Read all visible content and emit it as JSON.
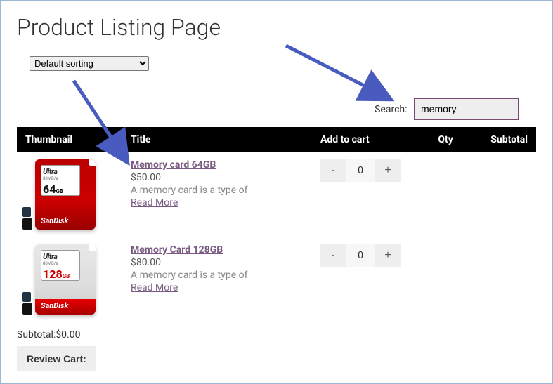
{
  "page": {
    "title": "Product Listing Page"
  },
  "sort": {
    "selected": "Default sorting"
  },
  "search": {
    "label": "Search:",
    "value": "memory"
  },
  "table": {
    "headers": {
      "thumbnail": "Thumbnail",
      "title": "Title",
      "addtocart": "Add to cart",
      "qty": "Qty",
      "subtotal": "Subtotal"
    }
  },
  "products": [
    {
      "title": "Memory card 64GB",
      "price": "$50.00",
      "desc": "A memory card is a type of",
      "readmore": "Read More",
      "qty": "0",
      "thumb": {
        "style": "red",
        "ultra": "Ultra",
        "capacity": "64",
        "brand": "SanDisk",
        "speed": "30MB/s",
        "gb": "GB"
      }
    },
    {
      "title": "Memory Card 128GB",
      "price": "$80.00",
      "desc": "A memory card is a type of",
      "readmore": "Read More",
      "qty": "0",
      "thumb": {
        "style": "silver",
        "ultra": "Ultra",
        "capacity": "128",
        "brand": "SanDisk",
        "speed": "80MB/s",
        "gb": "GB"
      }
    }
  ],
  "qty_buttons": {
    "minus": "-",
    "plus": "+"
  },
  "footer": {
    "subtotal_label": "Subtotal:",
    "subtotal_value": "$0.00",
    "review": "Review Cart:"
  }
}
